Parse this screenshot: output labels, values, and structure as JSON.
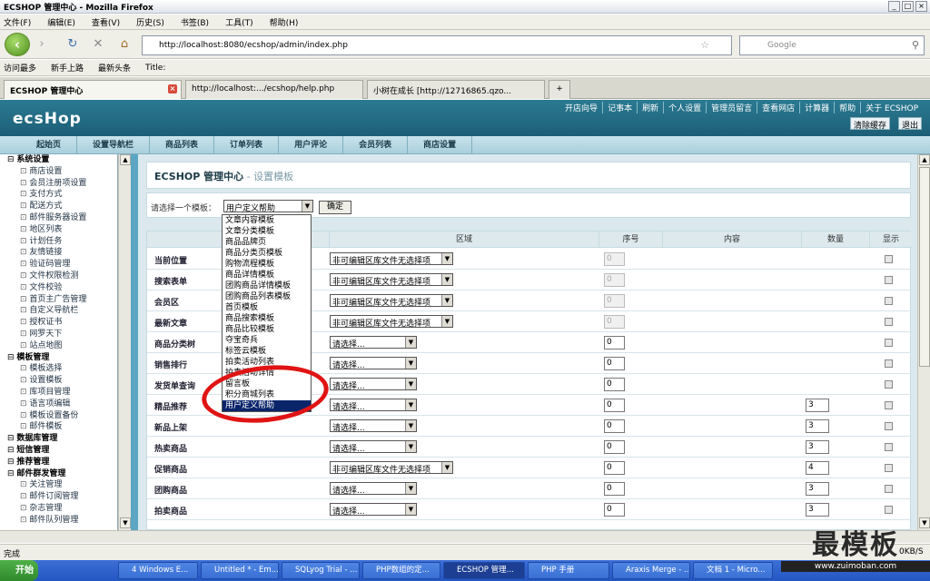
{
  "window": {
    "title": "ECSHOP 管理中心 - Mozilla Firefox"
  },
  "menu": [
    "文件(F)",
    "编辑(E)",
    "查看(V)",
    "历史(S)",
    "书签(B)",
    "工具(T)",
    "帮助(H)"
  ],
  "address": {
    "url": "http://localhost:8080/ecshop/admin/index.php"
  },
  "search": {
    "placeholder": "Google"
  },
  "bookmarks": [
    "访问最多",
    "新手上路",
    "最新头条",
    "Title:"
  ],
  "tabs": [
    "ECSHOP 管理中心",
    "http://localhost:.../ecshop/help.php",
    "小树在成长 [http://12716865.qzo..."
  ],
  "header": {
    "logo": "ecsHop",
    "links": [
      "开店向导",
      "记事本",
      "刷新",
      "个人设置",
      "管理员留言",
      "查看网店",
      "计算器",
      "帮助",
      "关于 ECSHOP"
    ],
    "clear_cache": "清除缓存",
    "logout": "退出"
  },
  "main_menu": [
    "起始页",
    "设置导航栏",
    "商品列表",
    "订单列表",
    "用户评论",
    "会员列表",
    "商店设置"
  ],
  "sidebar": [
    {
      "group": "系统设置",
      "items": [
        "商店设置",
        "会员注册项设置",
        "支付方式",
        "配送方式",
        "邮件服务器设置",
        "地区列表",
        "计划任务",
        "友情链接",
        "验证码管理",
        "文件权限检测",
        "文件校验",
        "首页主广告管理",
        "自定义导航栏",
        "授权证书",
        "网罗天下",
        "站点地图"
      ]
    },
    {
      "group": "模板管理",
      "items": [
        "模板选择",
        "设置模板",
        "库项目管理",
        "语言项编辑",
        "模板设置备份",
        "邮件模板"
      ]
    },
    {
      "group": "数据库管理",
      "items": []
    },
    {
      "group": "短信管理",
      "items": []
    },
    {
      "group": "推荐管理",
      "items": []
    },
    {
      "group": "邮件群发管理",
      "items": [
        "关注管理",
        "邮件订阅管理",
        "杂志管理",
        "邮件队列管理"
      ]
    }
  ],
  "page": {
    "title": "ECSHOP 管理中心",
    "subtitle": " - 设置模板",
    "select_label": "请选择一个模板：",
    "selected": "用户定义帮助",
    "ok": "确定"
  },
  "dropdown_options": [
    "文章内容模板",
    "文章分类模板",
    "商品品牌页",
    "商品分类页模板",
    "购物流程模板",
    "商品详情模板",
    "团购商品详情模板",
    "团购商品列表模板",
    "首页模板",
    "商品搜索模板",
    "商品比较模板",
    "夺宝奇兵",
    "标签云模板",
    "拍卖活动列表",
    "拍卖活动详情",
    "留言板",
    "积分商城列表",
    "用户定义帮助"
  ],
  "table": {
    "headers": [
      "区域",
      "序号",
      "内容",
      "数量",
      "显示"
    ],
    "rows": [
      {
        "label": "当前位置",
        "region": "非可编辑区库文件无选择项",
        "seq": "0",
        "qty": "",
        "disabled": true
      },
      {
        "label": "搜索表单",
        "region": "非可编辑区库文件无选择项",
        "seq": "0",
        "qty": "",
        "disabled": true
      },
      {
        "label": "会员区",
        "region": "非可编辑区库文件无选择项",
        "seq": "0",
        "qty": "",
        "disabled": true
      },
      {
        "label": "最新文章",
        "region": "非可编辑区库文件无选择项",
        "seq": "0",
        "qty": "",
        "disabled": true
      },
      {
        "label": "商品分类树",
        "region": "请选择...",
        "seq": "0",
        "qty": "",
        "disabled": false
      },
      {
        "label": "销售排行",
        "region": "请选择...",
        "seq": "0",
        "qty": "",
        "disabled": false
      },
      {
        "label": "发货单查询",
        "region": "请选择...",
        "seq": "0",
        "qty": "",
        "disabled": false
      },
      {
        "label": "精品推荐",
        "region": "请选择...",
        "seq": "0",
        "qty": "3",
        "disabled": false
      },
      {
        "label": "新品上架",
        "region": "请选择...",
        "seq": "0",
        "qty": "3",
        "disabled": false
      },
      {
        "label": "热卖商品",
        "region": "请选择...",
        "seq": "0",
        "qty": "3",
        "disabled": false
      },
      {
        "label": "促销商品",
        "region": "非可编辑区库文件无选择项",
        "seq": "0",
        "qty": "4",
        "disabled": false
      },
      {
        "label": "团购商品",
        "region": "请选择...",
        "seq": "0",
        "qty": "3",
        "disabled": false
      },
      {
        "label": "拍卖商品",
        "region": "请选择...",
        "seq": "0",
        "qty": "3",
        "disabled": false
      }
    ]
  },
  "status": {
    "text": "完成",
    "speed": "0KB/S"
  },
  "taskbar": {
    "start": "开始",
    "items": [
      "4 Windows E...",
      "Untitled * - Em...",
      "SQLyog Trial - ...",
      "PHP数组的定...",
      "ECSHOP 管理...",
      "PHP 手册",
      "Araxis Merge - ...",
      "文档 1 - Micro..."
    ]
  },
  "watermark": {
    "main": "最模板",
    "url": "www.zuimoban.com"
  }
}
